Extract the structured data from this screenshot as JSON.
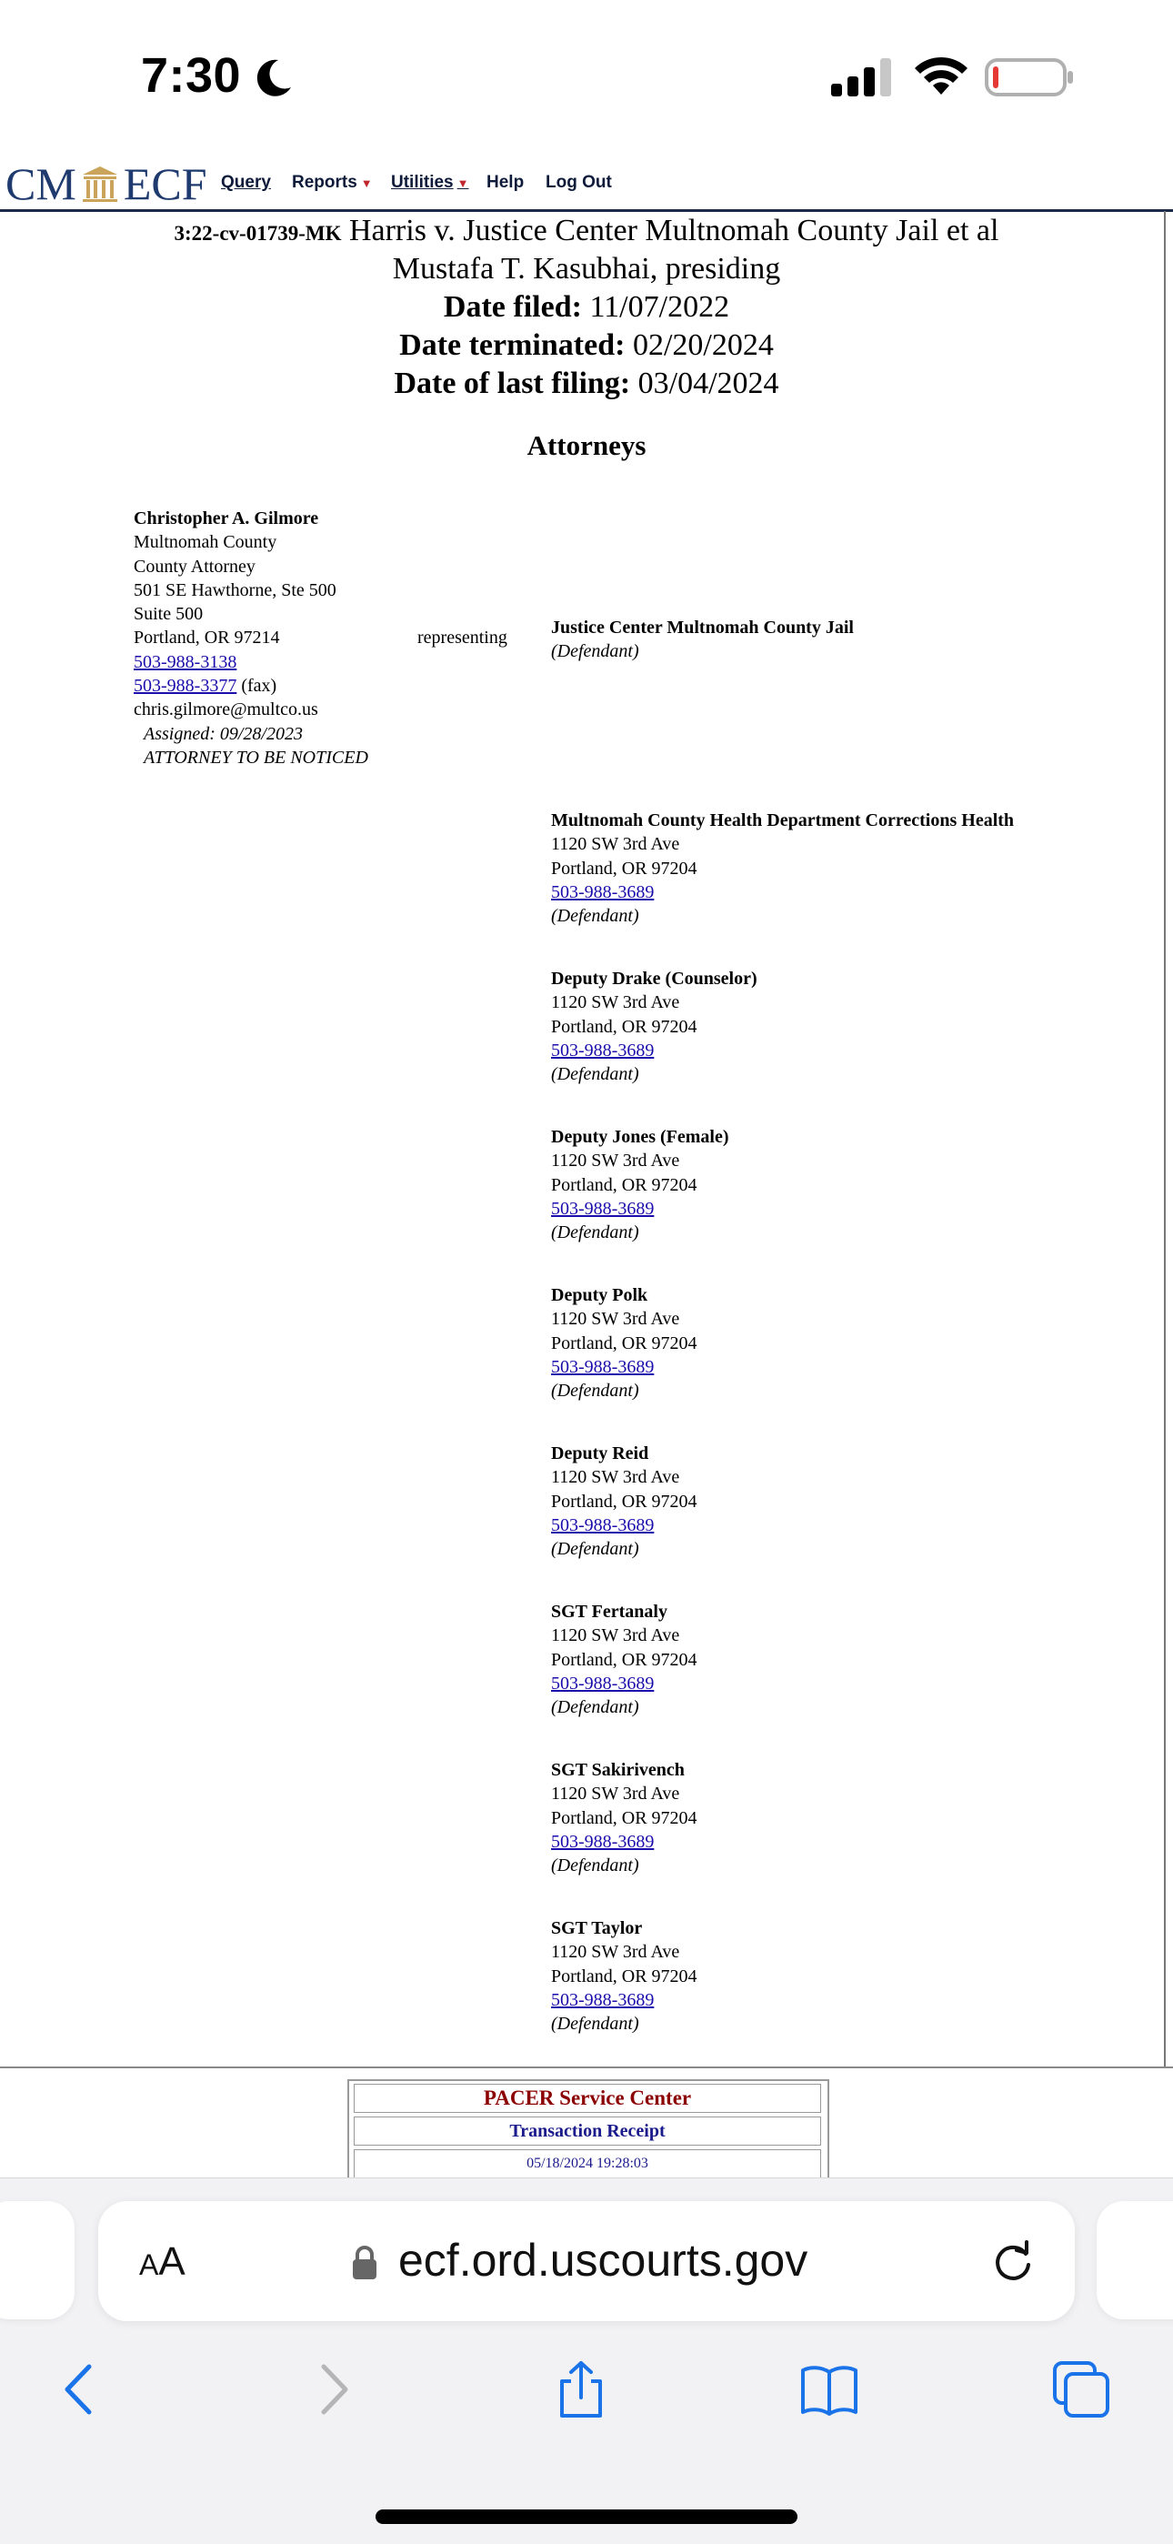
{
  "status_bar": {
    "time": "7:30"
  },
  "ecf": {
    "logo_left": "CM",
    "logo_right": "ECF",
    "menu": {
      "query": "Query",
      "reports": "Reports",
      "utilities": "Utilities",
      "help": "Help",
      "logout": "Log Out"
    }
  },
  "case": {
    "number": "3:22-cv-01739-MK",
    "title": "Harris v. Justice Center Multnomah County Jail et al",
    "judge": "Mustafa T. Kasubhai, presiding",
    "date_filed_label": "Date filed:",
    "date_filed": "11/07/2022",
    "date_terminated_label": "Date terminated:",
    "date_terminated": "02/20/2024",
    "last_filing_label": "Date of last filing:",
    "last_filing": "03/04/2024"
  },
  "attorneys_heading": "Attorneys",
  "attorney": {
    "name": "Christopher A. Gilmore",
    "line1": "Multnomah County",
    "line2": "County Attorney",
    "line3": "501 SE Hawthorne, Ste 500",
    "line4": "Suite 500",
    "line5": "Portland, OR 97214",
    "phone": "503-988-3138",
    "fax": "503-988-3377",
    "fax_suffix": " (fax)",
    "email": "chris.gilmore@multco.us",
    "assigned": "Assigned: 09/28/2023",
    "notice": "ATTORNEY TO BE NOTICED"
  },
  "representing_label": "representing",
  "parties": [
    {
      "name": "Justice Center Multnomah County Jail",
      "role": "(Defendant)"
    },
    {
      "name": "Multnomah County Health Department Corrections Health",
      "address1": "1120 SW 3rd Ave",
      "address2": "Portland, OR 97204",
      "phone": "503-988-3689",
      "role": "(Defendant)"
    },
    {
      "name": "Deputy Drake (Counselor)",
      "address1": "1120 SW 3rd Ave",
      "address2": "Portland, OR 97204",
      "phone": "503-988-3689",
      "role": "(Defendant)"
    },
    {
      "name": "Deputy Jones (Female)",
      "address1": "1120 SW 3rd Ave",
      "address2": "Portland, OR 97204",
      "phone": "503-988-3689",
      "role": "(Defendant)"
    },
    {
      "name": "Deputy Polk",
      "address1": "1120 SW 3rd Ave",
      "address2": "Portland, OR 97204",
      "phone": "503-988-3689",
      "role": "(Defendant)"
    },
    {
      "name": "Deputy Reid",
      "address1": "1120 SW 3rd Ave",
      "address2": "Portland, OR 97204",
      "phone": "503-988-3689",
      "role": "(Defendant)"
    },
    {
      "name": "SGT Fertanaly",
      "address1": "1120 SW 3rd Ave",
      "address2": "Portland, OR 97204",
      "phone": "503-988-3689",
      "role": "(Defendant)"
    },
    {
      "name": "SGT Sakirivench",
      "address1": "1120 SW 3rd Ave",
      "address2": "Portland, OR 97204",
      "phone": "503-988-3689",
      "role": "(Defendant)"
    },
    {
      "name": "SGT Taylor",
      "address1": "1120 SW 3rd Ave",
      "address2": "Portland, OR 97204",
      "phone": "503-988-3689",
      "role": "(Defendant)"
    }
  ],
  "pacer": {
    "title": "PACER Service Center",
    "subtitle": "Transaction Receipt",
    "timestamp": "05/18/2024 19:28:03"
  },
  "safari": {
    "aa_small": "A",
    "aa_big": "A",
    "url": "ecf.ord.uscourts.gov"
  },
  "colors": {
    "link": "#1a0dab",
    "ecf_navy": "#1f3a6e",
    "pacer_red": "#8b0000",
    "safari_blue": "#1a73e8",
    "battery_red": "#e53935"
  }
}
